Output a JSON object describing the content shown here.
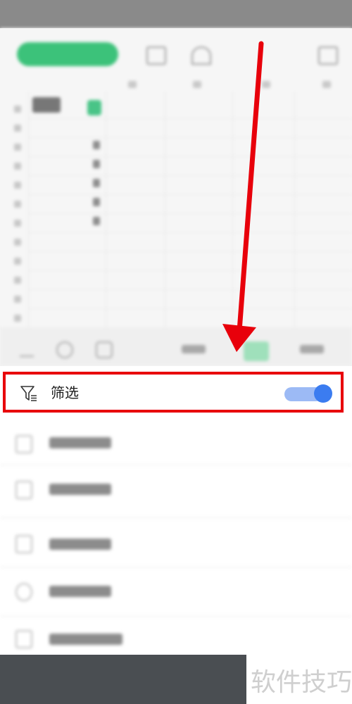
{
  "filter_row": {
    "label": "筛选",
    "toggle_on": true
  },
  "watermark": {
    "text": "软件技巧"
  },
  "colors": {
    "highlight": "#e8000b",
    "toggle_accent": "#3b7cf0",
    "toolbar_green": "#3cc27a"
  },
  "icons": [
    "filter-icon",
    "toggle-switch"
  ]
}
